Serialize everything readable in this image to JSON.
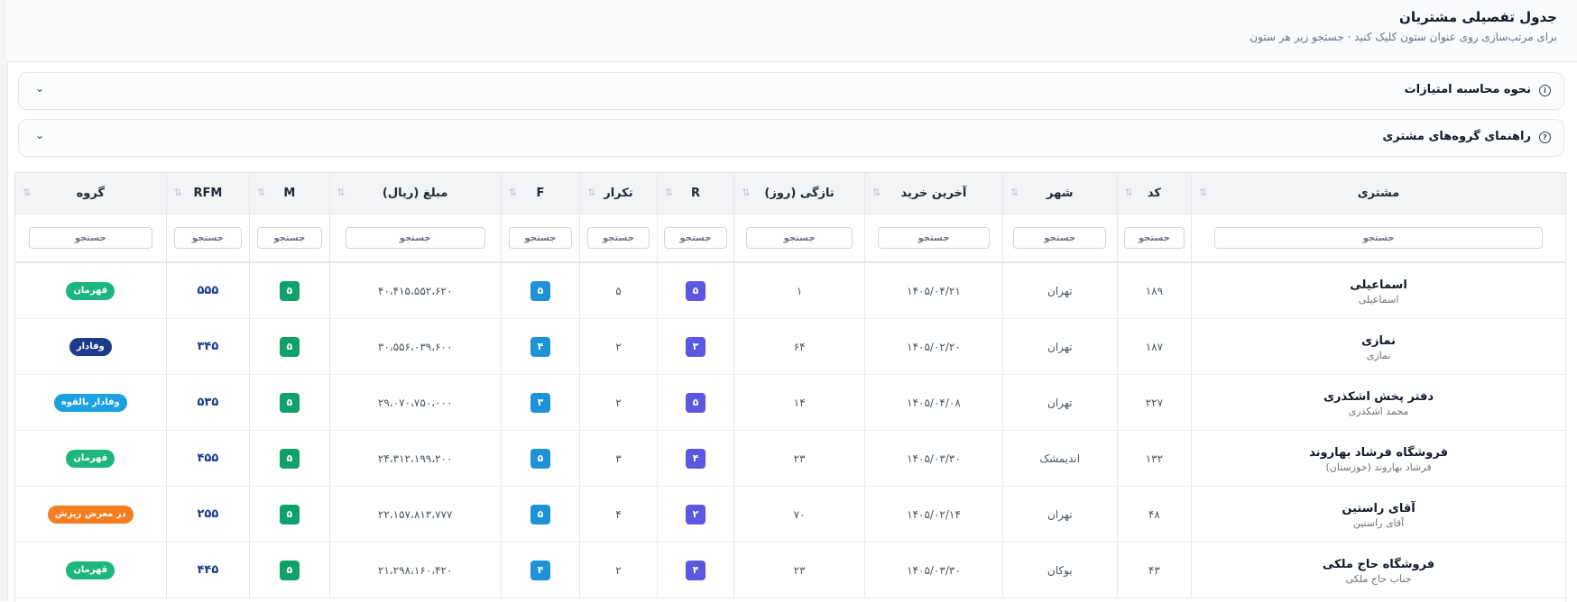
{
  "header": {
    "title": "جدول تفصیلی مشتریان",
    "subtitle": "برای مرتب‌سازی روی عنوان ستون کلیک کنید · جستجو زیر هر ستون"
  },
  "accordions": [
    {
      "label": "نحوه محاسبه امتیازات",
      "icon": "info-icon"
    },
    {
      "label": "راهنمای گروه‌های مشتری",
      "icon": "help-icon"
    }
  ],
  "table": {
    "columns": [
      "مشتری",
      "کد",
      "شهر",
      "آخرین خرید",
      "تازگی (روز)",
      "R",
      "تکرار",
      "F",
      "مبلغ (ریال)",
      "M",
      "RFM",
      "گروه"
    ],
    "filter_placeholder": "جستجو",
    "sort_icon": "⇅",
    "rows": [
      {
        "name": "اسماعیلی",
        "sub": "اسماعیلی",
        "code": "۱۸۹",
        "city": "تهران",
        "last": "۱۴۰۵/۰۴/۲۱",
        "recency": "۱",
        "r": "۵",
        "freq": "۵",
        "f": "۵",
        "amount": "۴۰،۴۱۵،۵۵۲،۶۲۰",
        "m": "۵",
        "rfm": "۵۵۵",
        "group": "قهرمان",
        "group_color": "#1cb67e"
      },
      {
        "name": "نمازی",
        "sub": "نمازی",
        "code": "۱۸۷",
        "city": "تهران",
        "last": "۱۴۰۵/۰۲/۲۰",
        "recency": "۶۴",
        "r": "۳",
        "freq": "۲",
        "f": "۴",
        "amount": "۳۰،۵۵۶،۰۳۹،۶۰۰",
        "m": "۵",
        "rfm": "۳۴۵",
        "group": "وفادار",
        "group_color": "#1e3a8a"
      },
      {
        "name": "دفتر پخش اشکذری",
        "sub": "محمد اشکذری",
        "code": "۲۲۷",
        "city": "تهران",
        "last": "۱۴۰۵/۰۴/۰۸",
        "recency": "۱۴",
        "r": "۵",
        "freq": "۲",
        "f": "۳",
        "amount": "۲۹،۰۷۰،۷۵۰،۰۰۰",
        "m": "۵",
        "rfm": "۵۳۵",
        "group": "وفادار بالقوه",
        "group_color": "#1ba1e2"
      },
      {
        "name": "فروشگاه فرشاد بهاروند",
        "sub": "فرشاد بهاروند (خوزستان)",
        "code": "۱۳۲",
        "city": "اندیمشک",
        "last": "۱۴۰۵/۰۳/۳۰",
        "recency": "۲۳",
        "r": "۴",
        "freq": "۳",
        "f": "۵",
        "amount": "۲۴،۳۱۲،۱۹۹،۲۰۰",
        "m": "۵",
        "rfm": "۴۵۵",
        "group": "قهرمان",
        "group_color": "#1cb67e"
      },
      {
        "name": "آقای راستین",
        "sub": "آقای راستین",
        "code": "۴۸",
        "city": "تهران",
        "last": "۱۴۰۵/۰۲/۱۴",
        "recency": "۷۰",
        "r": "۲",
        "freq": "۴",
        "f": "۵",
        "amount": "۲۲،۱۵۷،۸۱۳،۷۷۷",
        "m": "۵",
        "rfm": "۲۵۵",
        "group": "در معرض ریزش",
        "group_color": "#f57c1f"
      },
      {
        "name": "فروشگاه حاج ملکی",
        "sub": "جناب حاج ملکی",
        "code": "۴۳",
        "city": "بوکان",
        "last": "۱۴۰۵/۰۳/۳۰",
        "recency": "۲۳",
        "r": "۴",
        "freq": "۲",
        "f": "۴",
        "amount": "۲۱،۲۹۸،۱۶۰،۴۲۰",
        "m": "۵",
        "rfm": "۴۴۵",
        "group": "قهرمان",
        "group_color": "#1cb67e"
      }
    ]
  }
}
